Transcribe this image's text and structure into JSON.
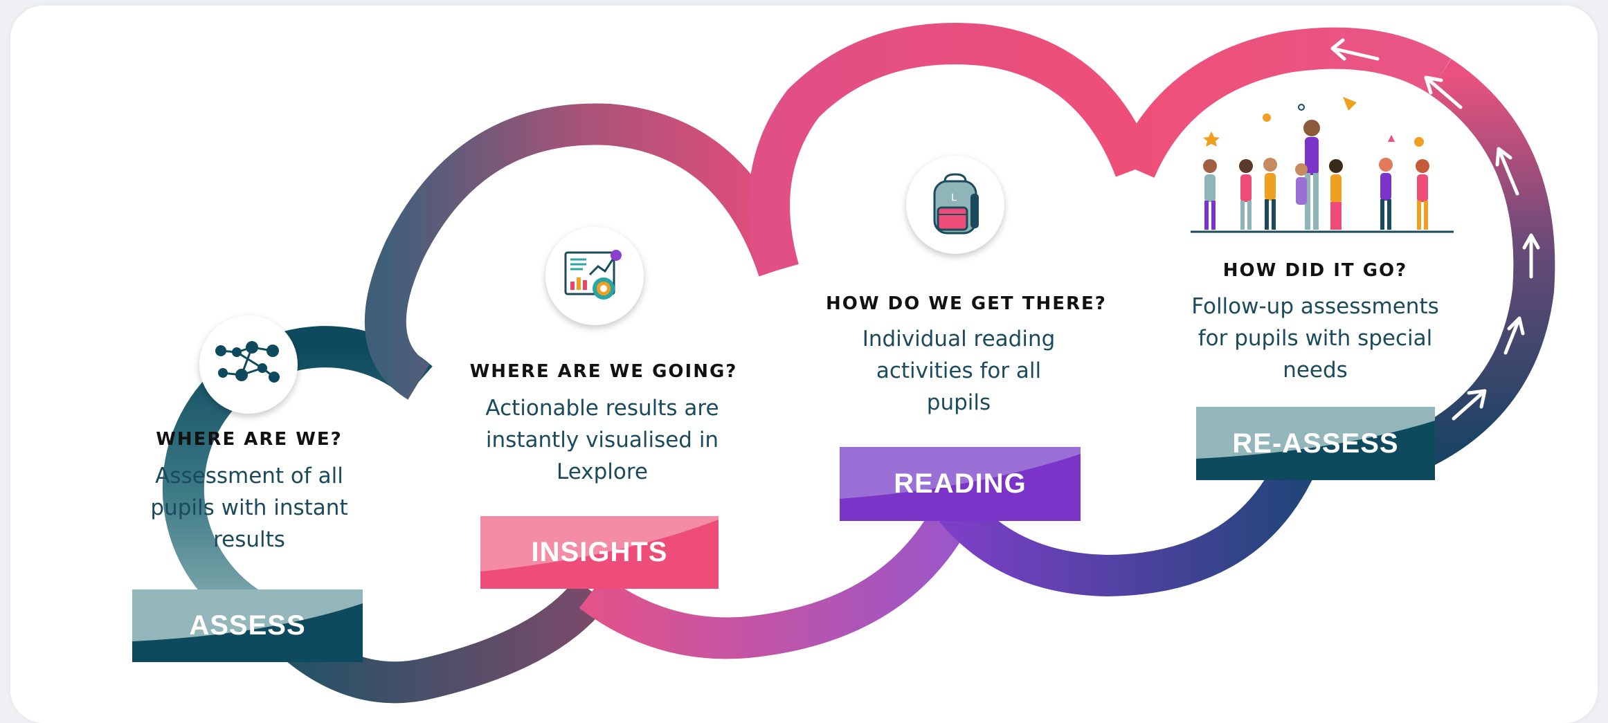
{
  "colors": {
    "teal_dark": "#0e4a5e",
    "teal_light": "#93b6bb",
    "pink": "#ee4d7a",
    "pink_light": "#f48ca5",
    "purple": "#7a34c8",
    "purple_light": "#9a6fd6",
    "navy": "#243e70"
  },
  "stages": [
    {
      "heading": "WHERE ARE WE?",
      "description": [
        "Assessment of all",
        "pupils with instant",
        "results"
      ],
      "label": "ASSESS",
      "icon": "network-nodes-icon"
    },
    {
      "heading": "WHERE ARE WE GOING?",
      "description": [
        "Actionable results are",
        "instantly visualised in",
        "Lexplore"
      ],
      "label": "INSIGHTS",
      "icon": "analytics-dashboard-icon"
    },
    {
      "heading": "HOW DO WE GET THERE?",
      "description": [
        "Individual reading",
        "activities for all",
        "pupils"
      ],
      "label": "READING",
      "icon": "backpack-icon"
    },
    {
      "heading": "HOW DID IT GO?",
      "description": [
        "Follow-up assessments",
        "for pupils with special",
        "needs"
      ],
      "label": "RE-ASSESS",
      "icon": "celebrating-children-illustration"
    }
  ]
}
